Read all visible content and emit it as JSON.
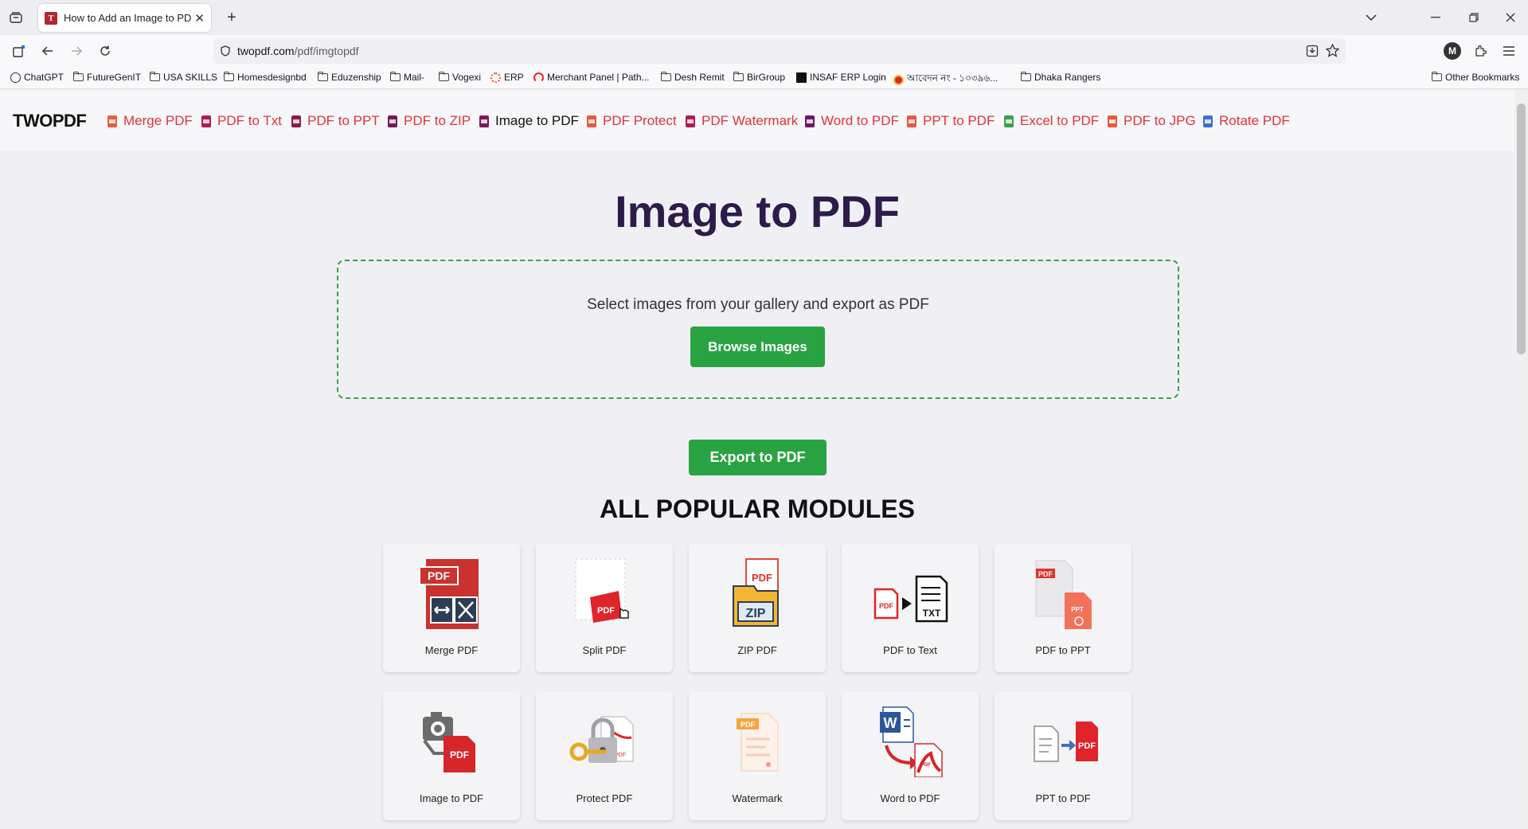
{
  "browser": {
    "tab_title": "How to Add an Image to PDF in",
    "tab_favicon_letter": "T",
    "url_host": "twopdf.com",
    "url_path": "/pdf/imgtopdf",
    "account_initial": "M",
    "bookmarks": [
      {
        "label": "ChatGPT",
        "icon": "chatgpt-icon"
      },
      {
        "label": "FutureGenIT",
        "icon": "folder-icon"
      },
      {
        "label": "USA SKILLS",
        "icon": "folder-icon"
      },
      {
        "label": "Homesdesignbd",
        "icon": "folder-icon"
      },
      {
        "label": "Eduzenship",
        "icon": "folder-icon"
      },
      {
        "label": "Mail-",
        "icon": "folder-icon"
      },
      {
        "label": "Vogexi",
        "icon": "folder-icon"
      },
      {
        "label": "ERP",
        "icon": "erp-icon"
      },
      {
        "label": "Merchant Panel | Path...",
        "icon": "pathao-icon"
      },
      {
        "label": "Desh Remit",
        "icon": "folder-icon"
      },
      {
        "label": "BirGroup",
        "icon": "folder-icon"
      },
      {
        "label": "INSAF ERP Login",
        "icon": "insaf-icon"
      },
      {
        "label": "আবেদন নং - ১০৩৯৬...",
        "icon": "gov-icon"
      },
      {
        "label": "Dhaka Rangers",
        "icon": "folder-icon"
      }
    ],
    "other_bookmarks": "Other Bookmarks"
  },
  "site": {
    "logo": "TWOPDF",
    "nav": [
      {
        "label": "Merge PDF",
        "color": "#e85d3a"
      },
      {
        "label": "PDF to Txt",
        "color": "#b31b4f"
      },
      {
        "label": "PDF to PPT",
        "color": "#8a1c4a"
      },
      {
        "label": "PDF to ZIP",
        "color": "#7a1a55"
      },
      {
        "label": "Image to PDF",
        "color": "#7a1a55"
      },
      {
        "label": "PDF Protect",
        "color": "#e8583a"
      },
      {
        "label": "PDF Watermark",
        "color": "#b31b4f"
      },
      {
        "label": "Word to PDF",
        "color": "#6a1a66"
      },
      {
        "label": "PPT to PDF",
        "color": "#e8583a"
      },
      {
        "label": "Excel to PDF",
        "color": "#3aa14a"
      },
      {
        "label": "PDF to JPG",
        "color": "#e8583a"
      },
      {
        "label": "Rotate PDF",
        "color": "#3d6ed8"
      }
    ],
    "active_nav": "Image to PDF"
  },
  "main": {
    "title": "Image to PDF",
    "dropzone_text": "Select images from your gallery and export as PDF",
    "browse_button": "Browse Images",
    "export_button": "Export to PDF",
    "modules_title": "ALL POPULAR MODULES",
    "modules": [
      {
        "label": "Merge PDF",
        "icon": "merge-pdf-icon"
      },
      {
        "label": "Split PDF",
        "icon": "split-pdf-icon"
      },
      {
        "label": "ZIP PDF",
        "icon": "zip-pdf-icon"
      },
      {
        "label": "PDF to Text",
        "icon": "pdf-to-text-icon"
      },
      {
        "label": "PDF to PPT",
        "icon": "pdf-to-ppt-icon"
      },
      {
        "label": "Image to PDF",
        "icon": "image-to-pdf-icon"
      },
      {
        "label": "Protect PDF",
        "icon": "protect-pdf-icon"
      },
      {
        "label": "Watermark",
        "icon": "watermark-icon"
      },
      {
        "label": "Word to PDF",
        "icon": "word-to-pdf-icon"
      },
      {
        "label": "PPT to PDF",
        "icon": "ppt-to-pdf-icon"
      }
    ],
    "icon_texts": {
      "pdf": "PDF",
      "zip": "ZIP",
      "txt": "TXT",
      "ppt": "PPT",
      "word": "W"
    }
  },
  "colors": {
    "accent_green": "#29a342",
    "title_purple": "#2d1c4a",
    "link_red": "#e2323a"
  }
}
